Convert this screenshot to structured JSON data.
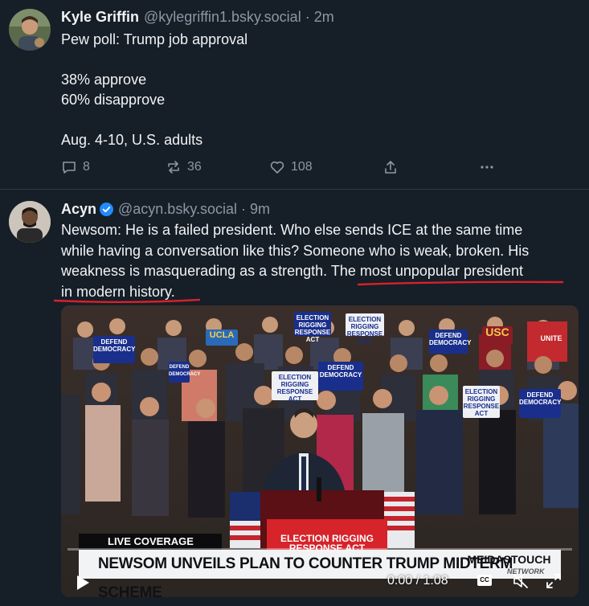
{
  "posts": [
    {
      "author": "Kyle Griffin",
      "handle": "@kylegriffin1.bsky.social",
      "separator": "·",
      "time": "2m",
      "lines": [
        "Pew poll: Trump job approval",
        "",
        "38% approve",
        "60% disapprove",
        "",
        "Aug. 4-10, U.S. adults"
      ],
      "replies": "8",
      "reposts": "36",
      "likes": "108"
    },
    {
      "author": "Acyn",
      "verified": true,
      "handle": "@acyn.bsky.social",
      "separator": "·",
      "time": "9m",
      "lines": [
        "Newsom: He is a failed president. Who else sends ICE at the same time",
        "while having a conversation like this? Someone who is weak, broken. His",
        "weakness is masquerading as a strength. The most unpopular president",
        "in modern history."
      ],
      "underline_color": "#d9202b"
    }
  ],
  "video": {
    "signs": [
      "DEFEND DEMOCRACY",
      "ELECTION RIGGING RESPONSE ACT",
      "USC",
      "UCLA",
      "UNITE"
    ],
    "live_banner": "LIVE COVERAGE",
    "podium_sign": "ELECTION RIGGING RESPONSE ACT",
    "chyron": "NEWSOM UNVEILS PLAN TO COUNTER TRUMP MIDTERM SCHEME",
    "brand": "MEIDASTOUCH",
    "brand_sub": "NETWORK",
    "time_display": "0:00 / 1:08",
    "cc_label": "CC"
  },
  "colors": {
    "background": "#161e27",
    "text": "#f1f3f5",
    "muted": "#8b98a5",
    "verified": "#208bfe",
    "underline": "#d9202b"
  }
}
